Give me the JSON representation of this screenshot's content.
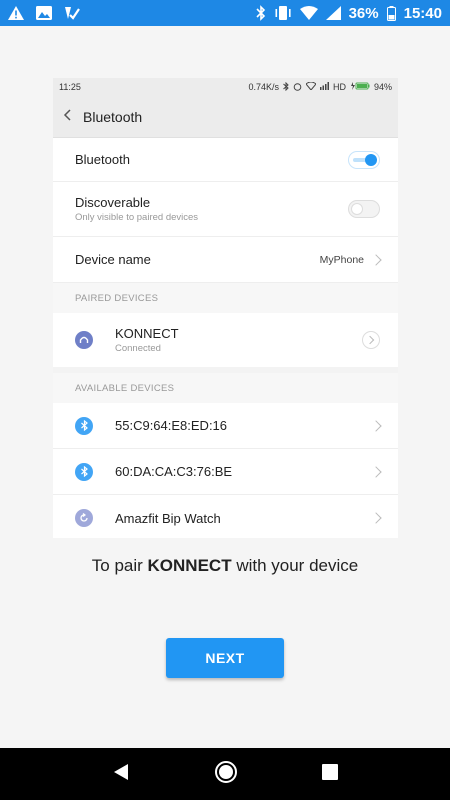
{
  "statusbar": {
    "battery": "36%",
    "time": "15:40",
    "icons": [
      "warning-icon",
      "image-icon",
      "app-check-icon",
      "bluetooth-icon",
      "vibrate-icon",
      "wifi-icon",
      "signal-icon",
      "battery-icon"
    ]
  },
  "inner": {
    "status": {
      "time": "11:25",
      "speed": "0.74K/s",
      "network": "HD",
      "battery": "94%"
    },
    "header": {
      "title": "Bluetooth"
    },
    "bluetooth": {
      "label": "Bluetooth",
      "on": true
    },
    "discoverable": {
      "label": "Discoverable",
      "sub": "Only visible to paired devices",
      "on": false
    },
    "device_name": {
      "label": "Device name",
      "value": "MyPhone"
    },
    "paired_header": "PAIRED DEVICES",
    "paired": [
      {
        "name": "KONNECT",
        "status": "Connected"
      }
    ],
    "available_header": "AVAILABLE DEVICES",
    "available": [
      {
        "name": "55:C9:64:E8:ED:16"
      },
      {
        "name": "60:DA:CA:C3:76:BE"
      },
      {
        "name": "Amazfit Bip Watch"
      }
    ]
  },
  "caption": {
    "prefix": "To pair ",
    "bold": "KONNECT",
    "suffix": " with your device"
  },
  "next_label": "NEXT",
  "colors": {
    "accent": "#2196f3",
    "statusbar": "#1e88e5"
  }
}
